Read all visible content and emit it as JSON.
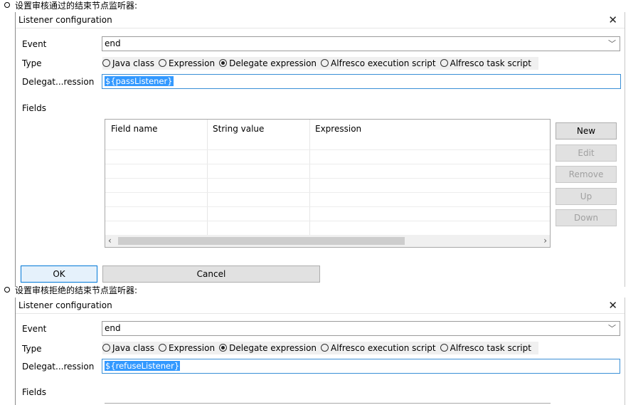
{
  "sections": [
    {
      "bullet_text": "设置审核通过的结束节点监听器:",
      "dialog_title": "Listener configuration",
      "event_label": "Event",
      "event_value": "end",
      "type_label": "Type",
      "type_options": [
        "Java class",
        "Expression",
        "Delegate expression",
        "Alfresco execution script",
        "Alfresco task script"
      ],
      "type_selected": "Delegate expression",
      "delegate_label": "Delegat...ression",
      "delegate_value": "${passListener}",
      "fields_label": "Fields",
      "table_headers": [
        "Field name",
        "String value",
        "Expression"
      ],
      "buttons": {
        "new": "New",
        "edit": "Edit",
        "remove": "Remove",
        "up": "Up",
        "down": "Down"
      },
      "ok": "OK",
      "cancel": "Cancel"
    },
    {
      "bullet_text": "设置审核拒绝的结束节点监听器:",
      "dialog_title": "Listener configuration",
      "event_label": "Event",
      "event_value": "end",
      "type_label": "Type",
      "type_options": [
        "Java class",
        "Expression",
        "Delegate expression",
        "Alfresco execution script",
        "Alfresco task script"
      ],
      "type_selected": "Delegate expression",
      "delegate_label": "Delegat...ression",
      "delegate_value": "${refuseListener}",
      "fields_label": "Fields"
    }
  ],
  "icons": {
    "close": "close-icon",
    "dropdown": "chevron-down-icon",
    "scroll_left": "scroll-left-icon",
    "scroll_right": "scroll-right-icon"
  },
  "colors": {
    "selection": "#3399ff",
    "focus_border": "#0078d7"
  }
}
